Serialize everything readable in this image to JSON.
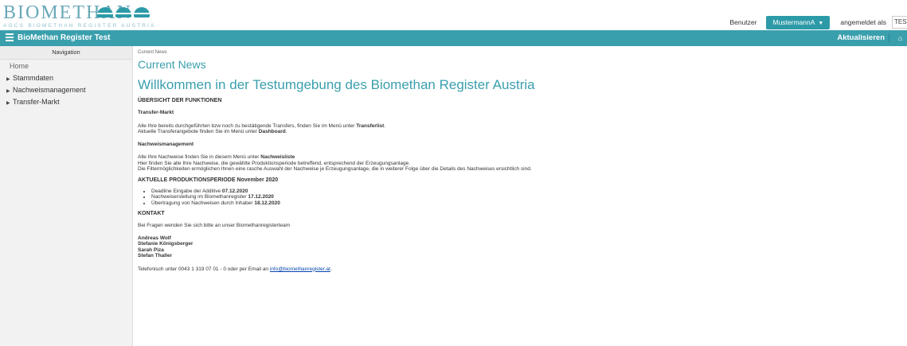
{
  "logo": {
    "word": "BIOMETHAN",
    "subtitle": "AGCS BIOMETHAN REGISTER AUSTRIA"
  },
  "header": {
    "benutzer_label": "Benutzer",
    "user_button": "MustermannA",
    "logged_in_label": "angemeldet als",
    "logged_in_value": "TEST"
  },
  "navbar": {
    "title": "BioMethan Register Test",
    "refresh_label": "Aktualisieren",
    "home_glyph": "⌂"
  },
  "sidebar": {
    "header": "Navigation",
    "items": [
      {
        "label": "Home"
      },
      {
        "label": "Stammdaten"
      },
      {
        "label": "Nachweismanagement"
      },
      {
        "label": "Transfer-Markt"
      }
    ]
  },
  "main": {
    "breadcrumb": "Current News",
    "title": "Current News",
    "welcome": "Willkommen in der Testumgebung des Biomethan Register Austria",
    "overview_heading": "ÜBERSICHT DER FUNKTIONEN",
    "transfer": {
      "heading": "Transfer-Markt",
      "line1_prefix": "Alle Ihre bereits durchgeführten bzw noch zu bestätigende Transfers, finden Sie im Menü unter ",
      "line1_bold": "Transferlist",
      "line1_suffix": ".",
      "line2_prefix": "Aktuelle Transferangebote finden Sie im Menü unter ",
      "line2_bold": "Dashboard",
      "line2_suffix": "."
    },
    "nachweis": {
      "heading": "Nachweismanagement",
      "line1_prefix": "Alle Ihre Nachweise finden Sie in diesem Menü unter ",
      "line1_bold": "Nachweisliste",
      "line2": "Hier finden Sie alle Ihre Nachweise, die gewählte Produktionsperiode betreffend, entsprechend der Erzeugungsanlage.",
      "line3": "Die Filtermöglichkeiten ermöglichen Ihnen eine rasche Auswahl der Nachweise je Erzeugungsanlage, die in weiterer Folge über die Details des Nachweises ersichtlich sind."
    },
    "period": {
      "heading": "AKTUELLE PRODUKTIONSPERIODE November 2020",
      "bullets": [
        {
          "text": "Deadline Eingabe der Additive ",
          "bold": "07.12.2020"
        },
        {
          "text": "Nachweiserstellung im Biomethanregister ",
          "bold": "17.12.2020"
        },
        {
          "text": "Übertragung von Nachweisen durch Inhaber ",
          "bold": "18.12.2020"
        }
      ]
    },
    "contact": {
      "heading": "KONTAKT",
      "intro": "Bei Fragen wenden Sie sich bitte an unser Biomethanregisterteam",
      "names": [
        "Andreas Wolf",
        "Stefanie Königsberger",
        "Sarah Piza",
        "Stefan Thaller"
      ],
      "phone_prefix": "Telefonisch unter 0043 1 319 07 01 - 0 oder per Email an ",
      "email": "info@biomethanregister.at",
      "phone_suffix": "."
    }
  }
}
